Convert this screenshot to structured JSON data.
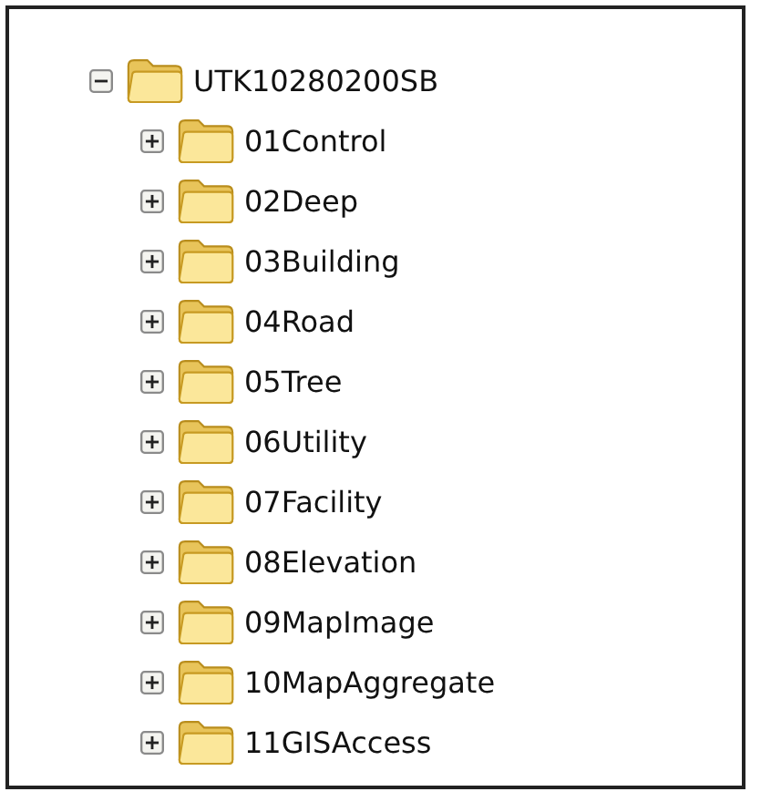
{
  "tree": [
    {
      "label": "UTK10280200SB",
      "expanded": true,
      "children": [
        {
          "label": "01Control",
          "expanded": false
        },
        {
          "label": "02Deep",
          "expanded": false
        },
        {
          "label": "03Building",
          "expanded": false
        },
        {
          "label": "04Road",
          "expanded": false
        },
        {
          "label": "05Tree",
          "expanded": false
        },
        {
          "label": "06Utility",
          "expanded": false
        },
        {
          "label": "07Facility",
          "expanded": false
        },
        {
          "label": "08Elevation",
          "expanded": false
        },
        {
          "label": "09MapImage",
          "expanded": false
        },
        {
          "label": "10MapAggregate",
          "expanded": false
        },
        {
          "label": "11GISAccess",
          "expanded": false
        }
      ]
    }
  ]
}
